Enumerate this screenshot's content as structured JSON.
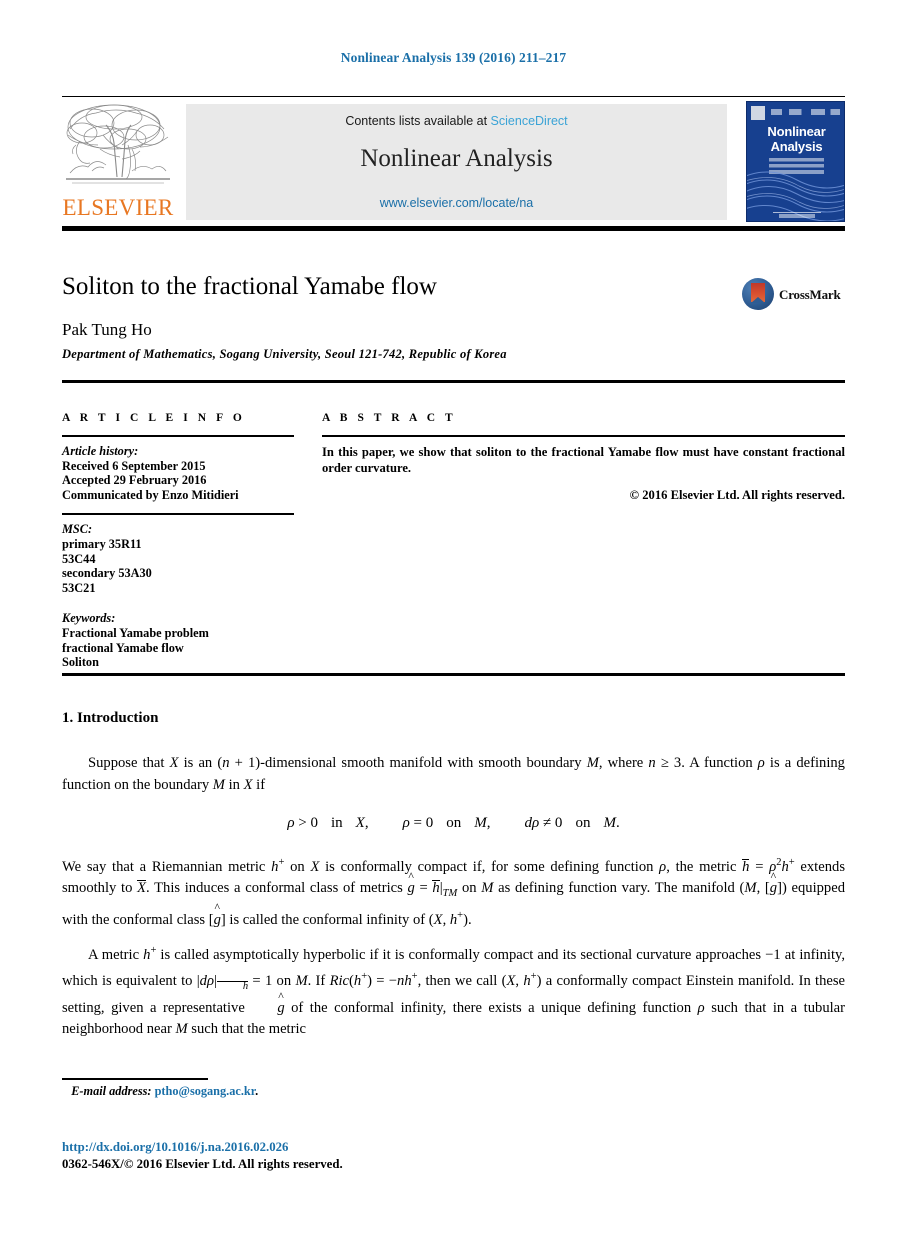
{
  "running_head": "Nonlinear Analysis 139 (2016) 211–217",
  "masthead": {
    "publisher_wordmark": "ELSEVIER",
    "contents_prefix": "Contents lists available at ",
    "sciencedirect": "ScienceDirect",
    "journal_title": "Nonlinear Analysis",
    "journal_url": "www.elsevier.com/locate/na",
    "cover_title_line1": "Nonlinear",
    "cover_title_line2": "Analysis"
  },
  "article": {
    "title": "Soliton to the fractional Yamabe flow",
    "author": "Pak Tung Ho",
    "affiliation": "Department of Mathematics, Sogang University, Seoul 121-742, Republic of Korea",
    "crossmark_label": "CrossMark"
  },
  "article_info": {
    "heading": "A R T I C L E   I N F O",
    "history_label": "Article history:",
    "received": "Received 6 September 2015",
    "accepted": "Accepted 29 February 2016",
    "communicated": "Communicated by Enzo Mitidieri",
    "msc_label": "MSC:",
    "msc": [
      "primary 35R11",
      "53C44",
      "secondary 53A30",
      "53C21"
    ],
    "keywords_label": "Keywords:",
    "keywords": [
      "Fractional Yamabe problem",
      "fractional Yamabe flow",
      "Soliton"
    ]
  },
  "abstract": {
    "heading": "A B S T R A C T",
    "text": "In this paper, we show that soliton to the fractional Yamabe flow must have constant fractional order curvature.",
    "copyright": "© 2016 Elsevier Ltd. All rights reserved."
  },
  "body": {
    "section_heading": "1. Introduction",
    "para1_a": "Suppose that ",
    "para1_b": " is an (",
    "para1_c": " + 1)-dimensional smooth manifold with smooth boundary ",
    "para1_d": ", where ",
    "para1_e": " ≥ 3. A function ",
    "para1_f": " is a defining function on the boundary ",
    "para1_g": " in ",
    "para1_h": " if",
    "equation": "ρ > 0   in X,     ρ = 0   on M,     dρ ≠ 0   on M.",
    "para2": "We say that a Riemannian metric h+ on X is conformally compact if, for some defining function ρ, the metric h̄ = ρ²h+ extends smoothly to X̄. This induces a conformal class of metrics ĝ = h̄|TM on M as defining function vary. The manifold (M, [ĝ]) equipped with the conformal class [ĝ] is called the conformal infinity of (X, h+).",
    "para3": "A metric h+ is called asymptotically hyperbolic if it is conformally compact and its sectional curvature approaches −1 at infinity, which is equivalent to |dρ|h̄ = 1 on M. If Ric(h+) = −nh+, then we call (X, h+) a conformally compact Einstein manifold. In these setting, given a representative ĝ of the conformal infinity, there exists a unique defining function ρ such that in a tubular neighborhood near M such that the metric"
  },
  "footer": {
    "email_label": "E-mail address:",
    "email": "ptho@sogang.ac.kr",
    "email_period": ".",
    "doi": "http://dx.doi.org/10.1016/j.na.2016.02.026",
    "issn_copyright": "0362-546X/© 2016 Elsevier Ltd. All rights reserved."
  },
  "colors": {
    "link_blue": "#1a6fa8",
    "sciencedirect_blue": "#3aa3d6",
    "elsevier_orange": "#E87722",
    "cover_blue": "#17408f",
    "banner_gray": "#e9e9e9"
  }
}
